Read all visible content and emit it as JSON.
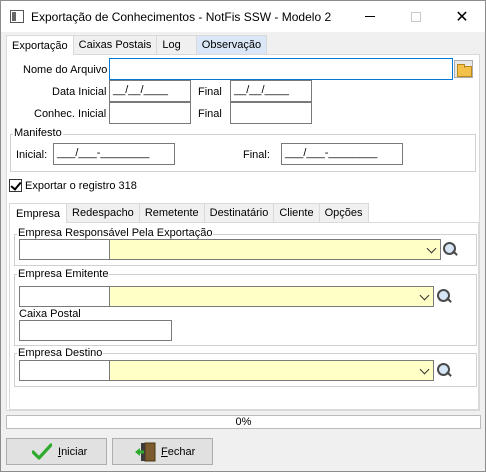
{
  "window": {
    "title": "Exportação de Conhecimentos - NotFis SSW - Modelo 2",
    "minimize": "—",
    "maximize": "☐",
    "close": "✕"
  },
  "tabs_top": [
    "Exportação",
    "Caixas Postais",
    "Log",
    "Observação"
  ],
  "form": {
    "nome_arquivo_label": "Nome do Arquivo",
    "nome_arquivo_value": "",
    "data_inicial_label": "Data Inicial",
    "data_inicial_value": "__/__/____",
    "data_final_label": "Final",
    "data_final_value": "__/__/____",
    "conhec_inicial_label": "Conhec. Inicial",
    "conhec_inicial_value": "",
    "conhec_final_label": "Final",
    "conhec_final_value": ""
  },
  "manifesto": {
    "title": "Manifesto",
    "inicial_label": "Inicial:",
    "inicial_value": "___/___-________",
    "final_label": "Final:",
    "final_value": "___/___-________"
  },
  "exportar_318": {
    "label": "Exportar o registro 318",
    "checked": true
  },
  "tabs_inner": [
    "Empresa",
    "Redespacho",
    "Remetente",
    "Destinatário",
    "Cliente",
    "Opções"
  ],
  "empresa": {
    "responsavel_title": "Empresa Responsável Pela Exportação",
    "emitente_title": "Empresa Emitente",
    "caixa_postal_label": "Caixa Postal",
    "destino_title": "Empresa Destino"
  },
  "progress": {
    "text": "0%",
    "value": 0
  },
  "buttons": {
    "iniciar": "Iniciar",
    "fechar": "Fechar"
  }
}
